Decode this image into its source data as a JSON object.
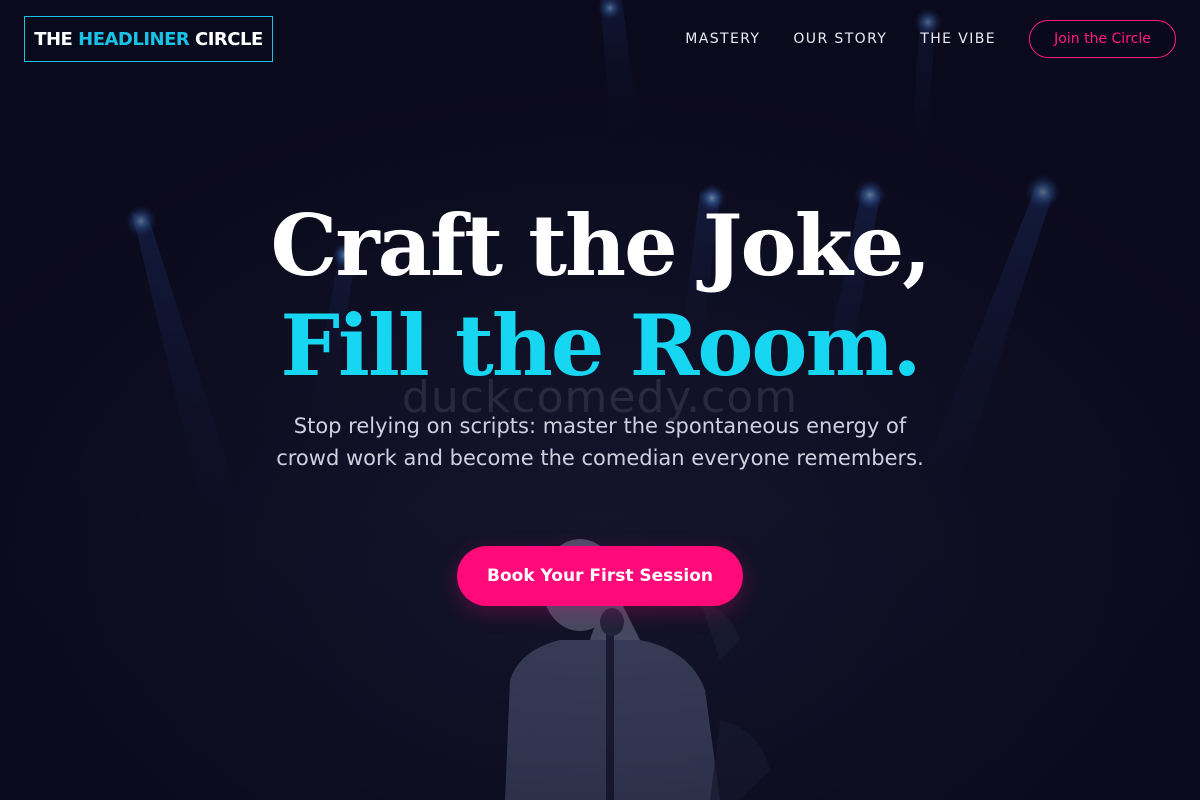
{
  "header": {
    "logo_part1": "THE ",
    "logo_accent": "HEADLINER",
    "logo_part2": " CIRCLE",
    "nav": [
      {
        "label": "MASTERY"
      },
      {
        "label": "OUR STORY"
      },
      {
        "label": "THE VIBE"
      }
    ],
    "join_label": "Join the Circle"
  },
  "hero": {
    "title_line1": "Craft the Joke,",
    "title_line2": "Fill the Room.",
    "subtitle": "Stop relying on scripts: master the spontaneous energy of crowd work and become the comedian everyone remembers.",
    "cta_label": "Book Your First Session",
    "watermark": "duckcomedy.com"
  },
  "colors": {
    "accent_cyan": "#17d6f2",
    "accent_pink": "#ff0a78",
    "background": "#0b0a1c"
  },
  "icons": {
    "background_image": "stage-performer-photo"
  }
}
